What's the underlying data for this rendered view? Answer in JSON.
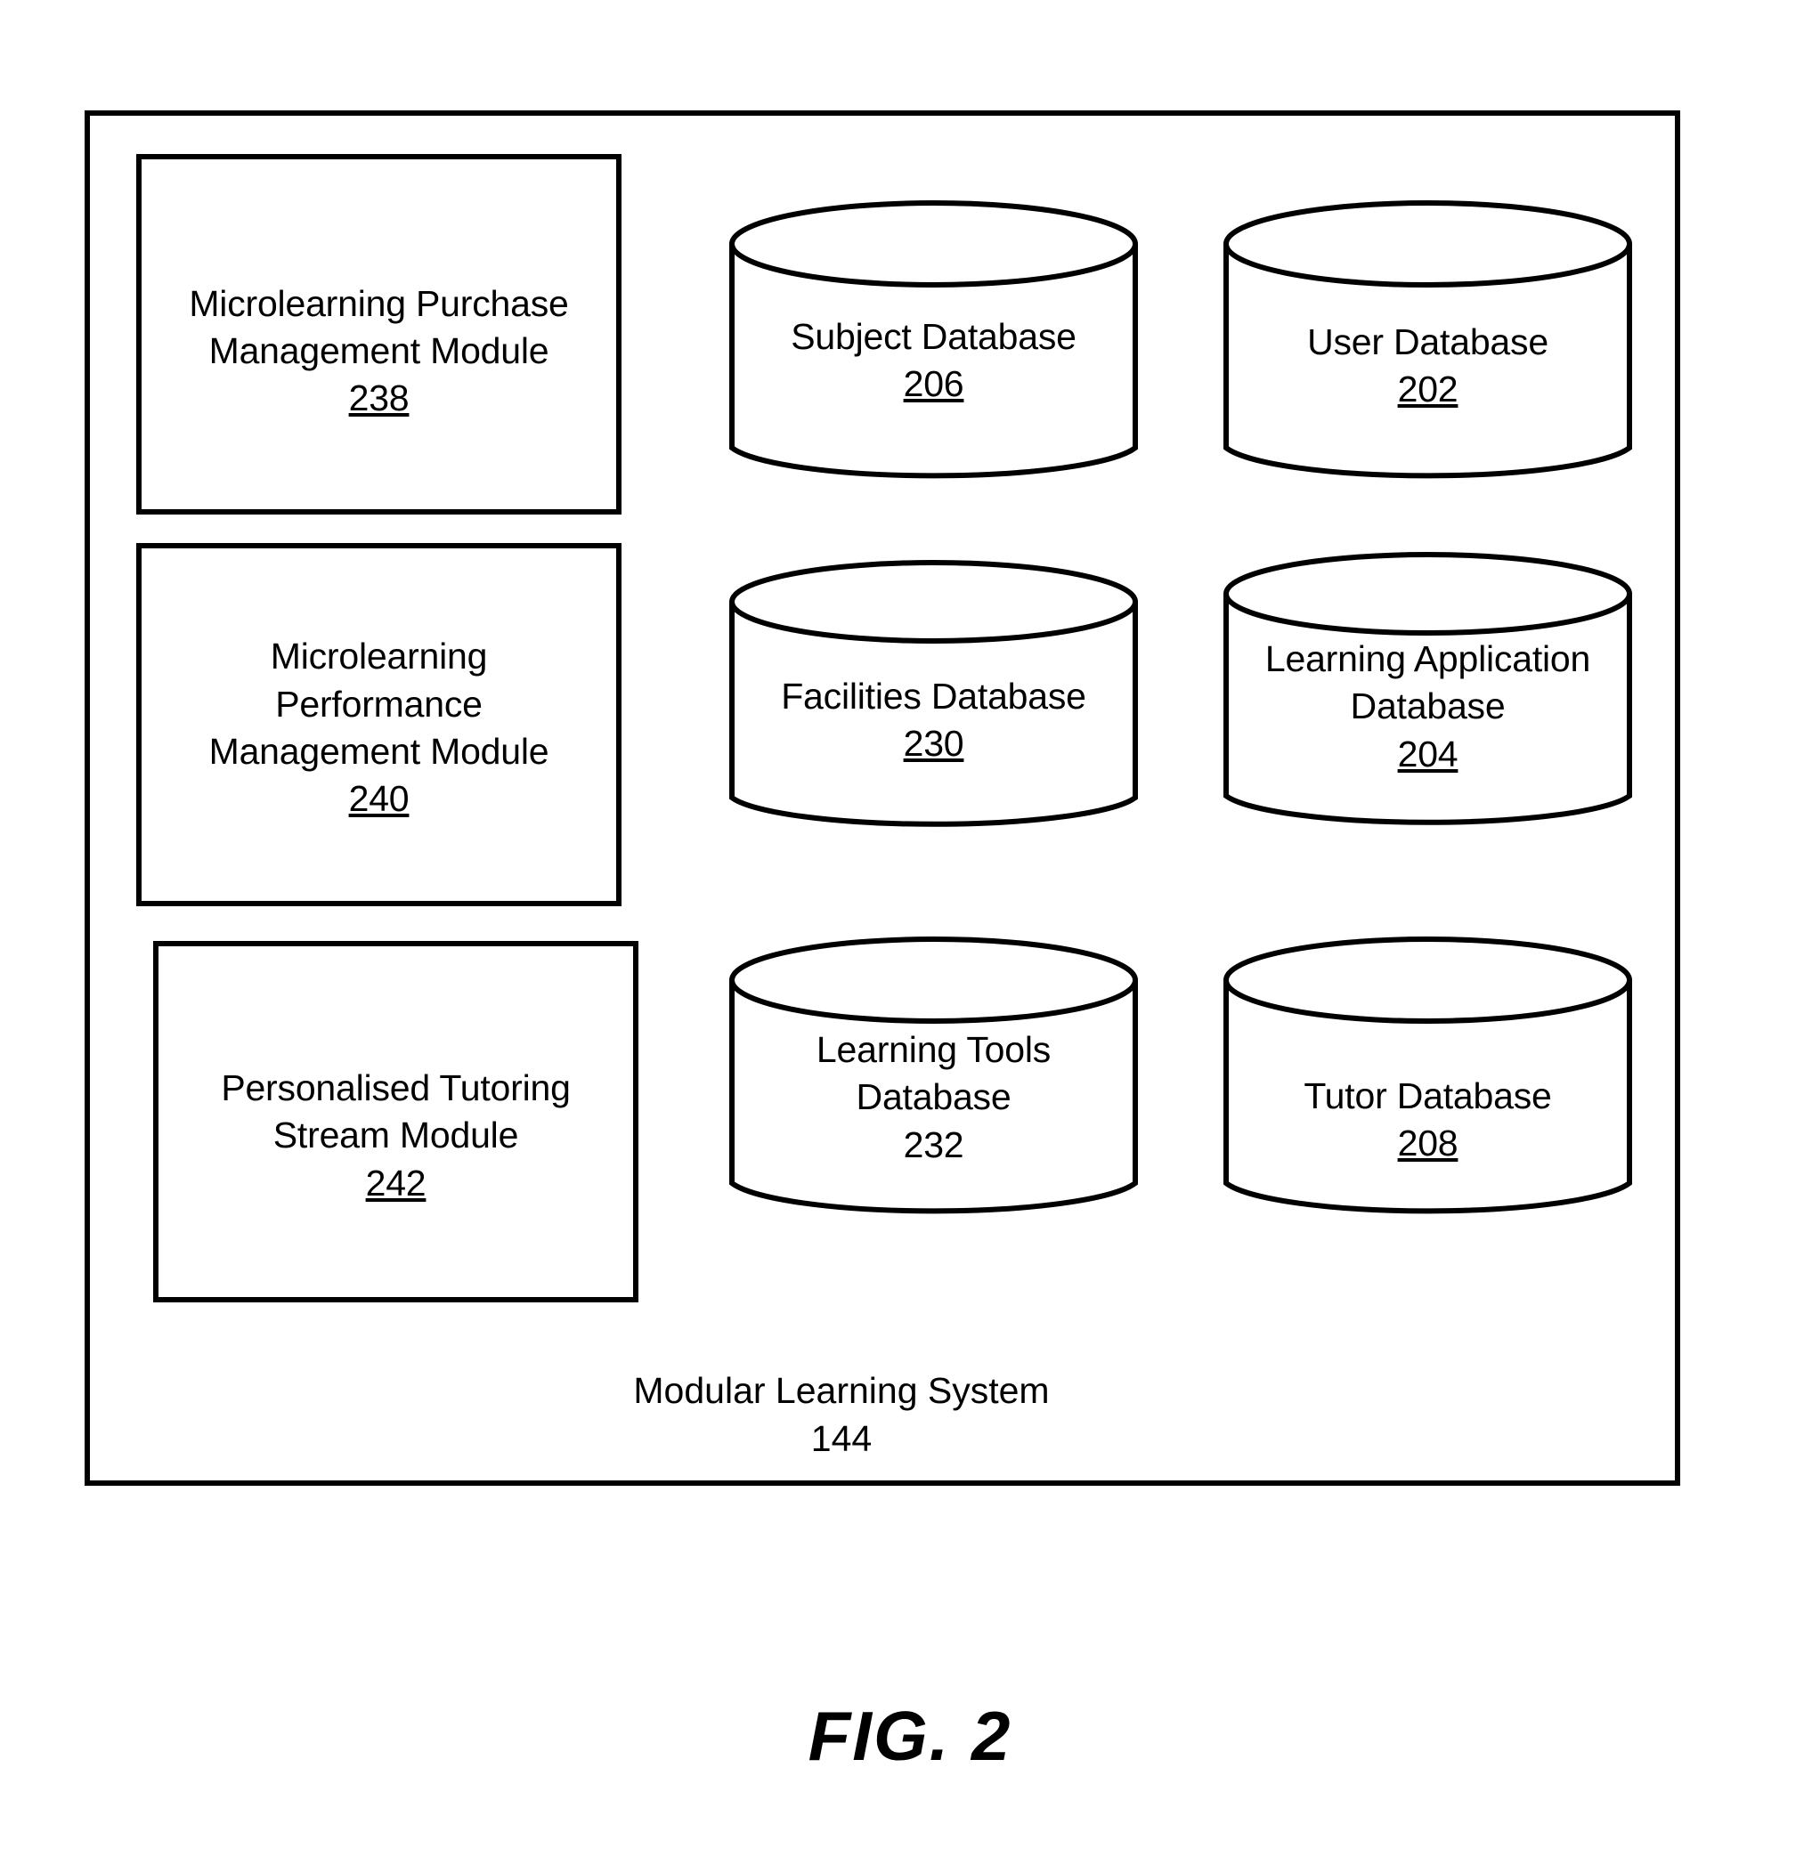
{
  "figure": {
    "caption": "FIG. 2",
    "system_title": "Modular Learning System",
    "system_ref": "144"
  },
  "modules": [
    {
      "id": "238",
      "line1": "Microlearning Purchase",
      "line2": "Management Module",
      "line3": "",
      "ref": "238",
      "ref_underlined": true
    },
    {
      "id": "240",
      "line1": "Microlearning",
      "line2": "Performance",
      "line3": "Management Module",
      "ref": "240",
      "ref_underlined": true
    },
    {
      "id": "242",
      "line1": "Personalised Tutoring",
      "line2": "Stream Module",
      "line3": "",
      "ref": "242",
      "ref_underlined": true
    }
  ],
  "databases": [
    {
      "id": "206",
      "line1": "Subject Database",
      "line2": "",
      "ref": "206",
      "ref_underlined": true
    },
    {
      "id": "202",
      "line1": "User Database",
      "line2": "",
      "ref": "202",
      "ref_underlined": true
    },
    {
      "id": "230",
      "line1": "Facilities Database",
      "line2": "",
      "ref": "230",
      "ref_underlined": true
    },
    {
      "id": "204",
      "line1": "Learning Application",
      "line2": "Database",
      "ref": "204",
      "ref_underlined": true
    },
    {
      "id": "232",
      "line1": "Learning Tools",
      "line2": "Database",
      "ref": "232",
      "ref_underlined": false
    },
    {
      "id": "208",
      "line1": "Tutor Database",
      "line2": "",
      "ref": "208",
      "ref_underlined": true
    }
  ],
  "colors": {
    "stroke": "#000000",
    "background": "#ffffff"
  }
}
